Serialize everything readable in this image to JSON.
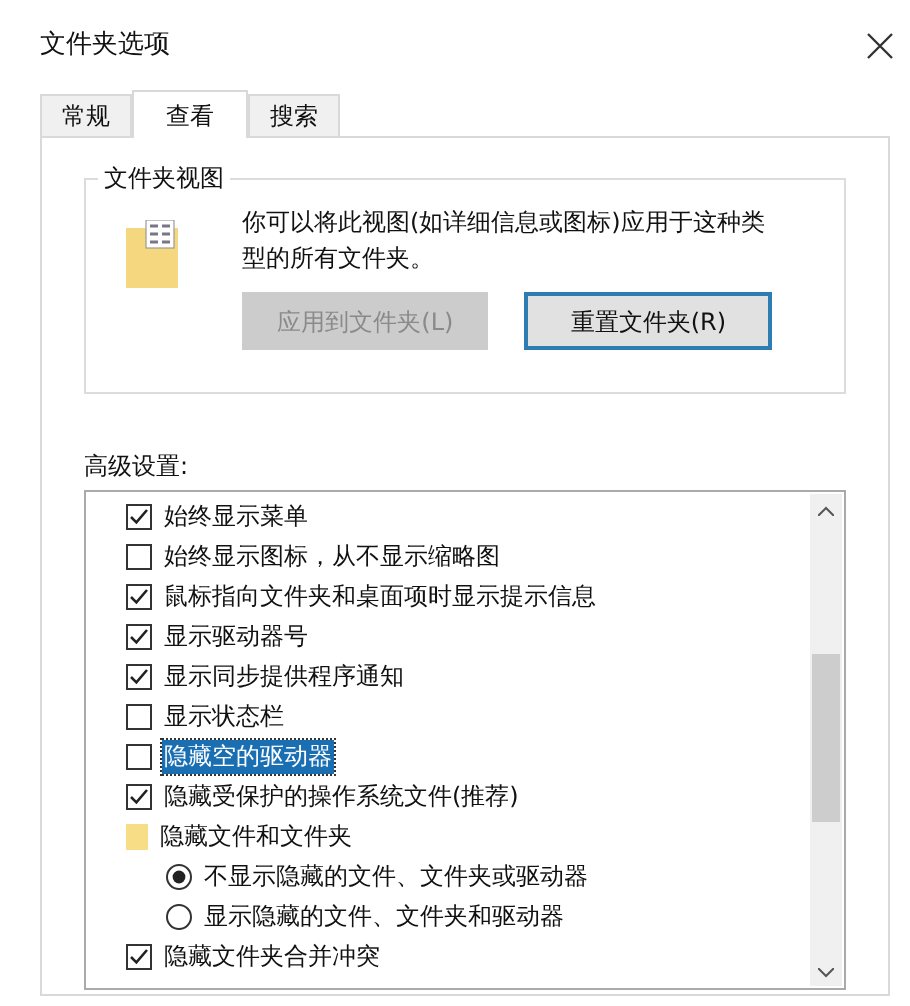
{
  "window": {
    "title": "文件夹选项"
  },
  "tabs": [
    {
      "label": "常规",
      "selected": false
    },
    {
      "label": "查看",
      "selected": true
    },
    {
      "label": "搜索",
      "selected": false
    }
  ],
  "folder_views": {
    "title": "文件夹视图",
    "description": "你可以将此视图(如详细信息或图标)应用于这种类型的所有文件夹。",
    "buttons": [
      {
        "label": "应用到文件夹(L)",
        "disabled": true
      },
      {
        "label": "重置文件夹(R)",
        "disabled": false
      }
    ]
  },
  "advanced": {
    "label": "高级设置:",
    "items": [
      {
        "kind": "checkbox",
        "label": "始终显示菜单",
        "checked": true,
        "selected": false
      },
      {
        "kind": "checkbox",
        "label": "始终显示图标，从不显示缩略图",
        "checked": false,
        "selected": false
      },
      {
        "kind": "checkbox",
        "label": "鼠标指向文件夹和桌面项时显示提示信息",
        "checked": true,
        "selected": false
      },
      {
        "kind": "checkbox",
        "label": "显示驱动器号",
        "checked": true,
        "selected": false
      },
      {
        "kind": "checkbox",
        "label": "显示同步提供程序通知",
        "checked": true,
        "selected": false
      },
      {
        "kind": "checkbox",
        "label": "显示状态栏",
        "checked": false,
        "selected": false
      },
      {
        "kind": "checkbox",
        "label": "隐藏空的驱动器",
        "checked": false,
        "selected": true
      },
      {
        "kind": "checkbox",
        "label": "隐藏受保护的操作系统文件(推荐)",
        "checked": true,
        "selected": false
      },
      {
        "kind": "folder",
        "label": "隐藏文件和文件夹",
        "selected": false,
        "children": [
          {
            "kind": "radio",
            "label": "不显示隐藏的文件、文件夹或驱动器",
            "checked": true,
            "selected": false
          },
          {
            "kind": "radio",
            "label": "显示隐藏的文件、文件夹和驱动器",
            "checked": false,
            "selected": false
          }
        ]
      },
      {
        "kind": "checkbox",
        "label": "隐藏文件夹合并冲突",
        "checked": true,
        "selected": false
      }
    ]
  }
}
